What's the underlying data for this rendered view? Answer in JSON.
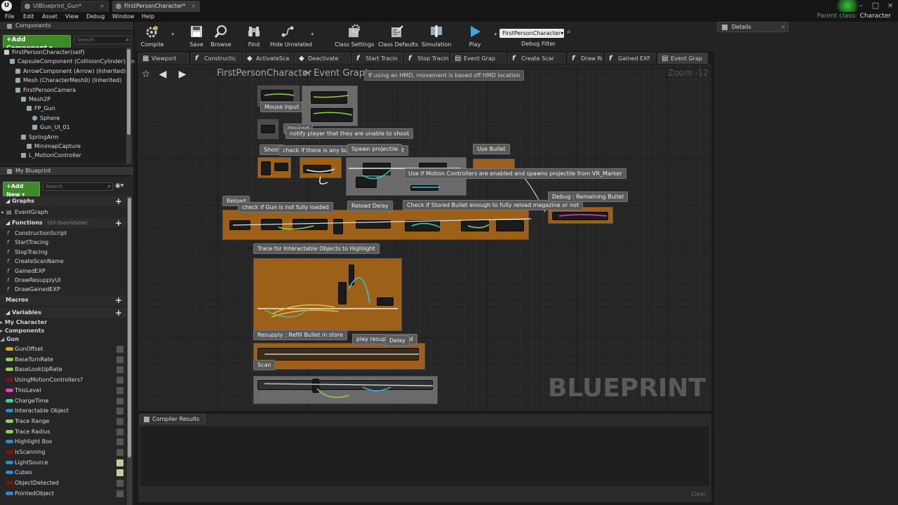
{
  "window": {
    "tabs": [
      {
        "label": "UIBlueprint_Gun*"
      },
      {
        "label": "FirstPersonCharacter*"
      }
    ],
    "parent_class_label": "Parent class:",
    "parent_class_value": "Character",
    "logo_text": "U"
  },
  "menubar": [
    "File",
    "Edit",
    "Asset",
    "View",
    "Debug",
    "Window",
    "Help"
  ],
  "components_panel": {
    "title": "Components",
    "add_label": "+Add Component ▾",
    "search_placeholder": "Search",
    "tree": [
      {
        "label": "FirstPersonCharacter(self)",
        "depth": 0
      },
      {
        "label": "CapsuleComponent (CollisionCylinder) (Inherited)",
        "depth": 1
      },
      {
        "label": "ArrowComponent (Arrow) (Inherited)",
        "depth": 2
      },
      {
        "label": "Mesh (CharacterMesh0) (Inherited)",
        "depth": 2
      },
      {
        "label": "FirstPersonCamera",
        "depth": 2
      },
      {
        "label": "Mesh2P",
        "depth": 3
      },
      {
        "label": "FP_Gun",
        "depth": 4
      },
      {
        "label": "Sphere",
        "depth": 5
      },
      {
        "label": "Gun_UI_01",
        "depth": 5
      },
      {
        "label": "SpringArm",
        "depth": 3
      },
      {
        "label": "MinimapCapture",
        "depth": 4
      },
      {
        "label": "L_MotionController",
        "depth": 3
      }
    ]
  },
  "myblueprint_panel": {
    "title": "My Blueprint",
    "add_label": "+Add New ▾",
    "search_placeholder": "Search",
    "graphs_header": "Graphs",
    "graphs": [
      "EventGraph"
    ],
    "functions_header": "Functions",
    "functions_note": "(29 Overridable)",
    "functions": [
      "ConstructionScript",
      "StartTracing",
      "StopTracing",
      "CreateScanName",
      "GainedEXP",
      "DrawResupplyUI",
      "DrawGainedEXP"
    ],
    "macros_header": "Macros",
    "variables_header": "Variables",
    "categories": [
      "My Character",
      "Components",
      "Gun"
    ],
    "variables": [
      {
        "name": "GunOffset",
        "color": "#d4aa1c",
        "eye": false
      },
      {
        "name": "BaseTurnRate",
        "color": "#8fd14f",
        "eye": false
      },
      {
        "name": "BaseLookUpRate",
        "color": "#8fd14f",
        "eye": false
      },
      {
        "name": "UsingMotionControllers?",
        "color": "#8c1010",
        "eye": false
      },
      {
        "name": "ThisLevel",
        "color": "#e040c0",
        "eye": false
      },
      {
        "name": "ChargeTime",
        "color": "#30d9a0",
        "eye": false
      },
      {
        "name": "Interactable Object",
        "color": "#2a8ad6",
        "eye": false
      },
      {
        "name": "Trace Range",
        "color": "#8fd14f",
        "eye": false
      },
      {
        "name": "Trace Radius",
        "color": "#8fd14f",
        "eye": false
      },
      {
        "name": "Highlight Box",
        "color": "#2a8ad6",
        "eye": false
      },
      {
        "name": "IsScanning",
        "color": "#8c1010",
        "eye": false
      },
      {
        "name": "LightSource",
        "color": "#2a8ad6",
        "eye": true
      },
      {
        "name": "Cubes",
        "color": "#2a8ad6",
        "eye": true
      },
      {
        "name": "ObjectDetected",
        "color": "#8c1010",
        "eye": false
      },
      {
        "name": "PointedObject",
        "color": "#2a8ad6",
        "eye": false
      }
    ]
  },
  "toolbar": [
    {
      "label": "Compile",
      "icon": "compile-icon",
      "caret": true
    },
    {
      "label": "Save",
      "icon": "save-icon"
    },
    {
      "label": "Browse",
      "icon": "browse-icon"
    },
    {
      "label": "Find",
      "icon": "find-icon"
    },
    {
      "label": "Hide Unrelated",
      "icon": "hide-unrelated-icon",
      "caret": true
    },
    {
      "label": "Class Settings",
      "icon": "class-settings-icon"
    },
    {
      "label": "Class Defaults",
      "icon": "class-defaults-icon"
    },
    {
      "label": "Simulation",
      "icon": "simulation-icon"
    },
    {
      "label": "Play",
      "icon": "play-icon",
      "caret": true
    }
  ],
  "debug_filter": {
    "value": "FirstPersonCharacter▾",
    "label": "Debug Filter"
  },
  "doc_tabs": [
    {
      "label": "Viewport",
      "kind": "viewport"
    },
    {
      "label": "Constructic",
      "kind": "function"
    },
    {
      "label": "ActivateSca",
      "kind": "event"
    },
    {
      "label": "Deactivate",
      "kind": "event"
    },
    {
      "label": "Start Tracin",
      "kind": "function"
    },
    {
      "label": "Stop Tracin",
      "kind": "function"
    },
    {
      "label": "Event Grap",
      "kind": "graph"
    },
    {
      "label": "Create Scar",
      "kind": "function"
    },
    {
      "label": "Draw Resup",
      "kind": "function"
    },
    {
      "label": "Gained EXF",
      "kind": "function"
    },
    {
      "label": "Event Grap",
      "kind": "graph",
      "active": true
    }
  ],
  "graph": {
    "breadcrumb": [
      "FirstPersonCharacter",
      "Event Graph"
    ],
    "zoom": "Zoom -12",
    "watermark": "BLUEPRINT",
    "comments": [
      "If using an HMD, movement is based off HMD location",
      "Mouse input",
      "Unused",
      "notify player that they are unable to shoot",
      "Shoot",
      "check if there is any bullet in magazine left",
      "Spawn projectile",
      "Use Bullet",
      "Use if Motion Controllers are enabled and spawns projectile from VR_Marker",
      "Reload",
      "check if Gun is not fully loaded",
      "Reload Delay",
      "Check if Stored Bullet enough to fully reload magazine or not",
      "Debug : Remaining Bullet",
      "Trace for Interactable Objects to Highlight",
      "Resupply : Refill Bullet in store",
      "play resupply sound",
      "Delay",
      "Scan"
    ]
  },
  "compiler": {
    "tab_label": "Compiler Results",
    "clear_label": "Clear"
  },
  "details": {
    "tab_label": "Details"
  }
}
